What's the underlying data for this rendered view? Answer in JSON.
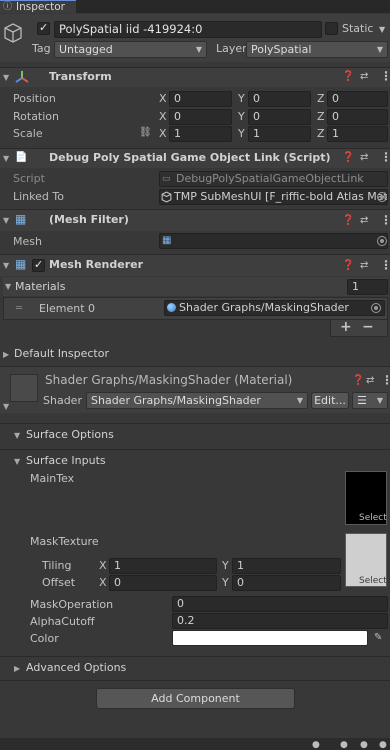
{
  "tab": {
    "title": "Inspector"
  },
  "header": {
    "object_name": "PolySpatial iid -419924:0",
    "static_label": "Static",
    "tag_label": "Tag",
    "tag_value": "Untagged",
    "layer_label": "Layer",
    "layer_value": "PolySpatial"
  },
  "transform": {
    "title": "Transform",
    "rows": [
      {
        "label": "Position",
        "x": "0",
        "y": "0",
        "z": "0"
      },
      {
        "label": "Rotation",
        "x": "0",
        "y": "0",
        "z": "0"
      },
      {
        "label": "Scale",
        "x": "1",
        "y": "1",
        "z": "1"
      }
    ],
    "axis_x": "X",
    "axis_y": "Y",
    "axis_z": "Z"
  },
  "debug_link": {
    "title": "Debug Poly Spatial Game Object Link (Script)",
    "script_label": "Script",
    "script_value": "DebugPolySpatialGameObjectLink",
    "linked_label": "Linked To",
    "linked_value": "TMP SubMeshUI [F_riffic-bold Atlas Mate"
  },
  "mesh_filter": {
    "title": "(Mesh Filter)",
    "mesh_label": "Mesh",
    "mesh_value": ""
  },
  "mesh_renderer": {
    "title": "Mesh Renderer",
    "materials_label": "Materials",
    "materials_count": "1",
    "element_label": "Element 0",
    "element_value": "Shader Graphs/MaskingShader",
    "plus": "+",
    "minus": "−"
  },
  "default_inspector": {
    "title": "Default Inspector"
  },
  "material": {
    "title": "Shader Graphs/MaskingShader (Material)",
    "shader_label": "Shader",
    "shader_value": "Shader Graphs/MaskingShader",
    "edit_label": "Edit...",
    "list_label": "☰"
  },
  "surface_options": {
    "title": "Surface Options"
  },
  "surface_inputs": {
    "title": "Surface Inputs",
    "maintex_label": "MainTex",
    "select": "Select",
    "masktexture_label": "MaskTexture",
    "tiling_label": "Tiling",
    "tiling_x": "1",
    "tiling_y": "1",
    "offset_label": "Offset",
    "offset_x": "0",
    "offset_y": "0",
    "axis_x": "X",
    "axis_y": "Y",
    "maskop_label": "MaskOperation",
    "maskop_value": "0",
    "alpha_label": "AlphaCutoff",
    "alpha_value": "0.2",
    "color_label": "Color",
    "color_value": "#ffffff"
  },
  "advanced": {
    "title": "Advanced Options"
  },
  "add_component": {
    "label": "Add Component"
  },
  "colors": {
    "bg": "#383838",
    "header": "#3e3e3e",
    "field": "#2a2a2a"
  }
}
